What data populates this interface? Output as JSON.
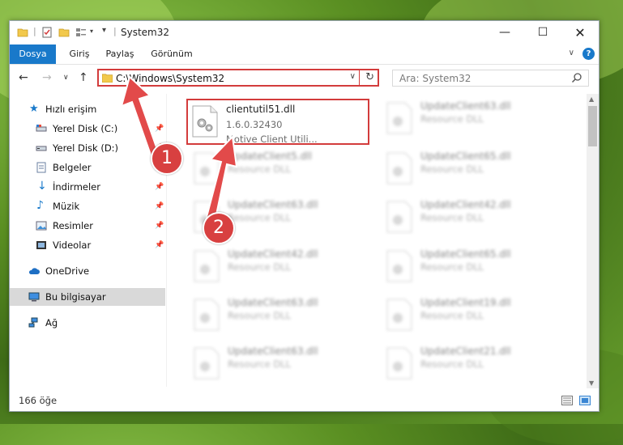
{
  "window": {
    "title": "System32"
  },
  "ribbon": {
    "tabs": [
      "Dosya",
      "Giriş",
      "Paylaş",
      "Görünüm"
    ],
    "help": "?"
  },
  "address": {
    "path": "C:\\Windows\\System32"
  },
  "search": {
    "placeholder": "Ara: System32"
  },
  "sidebar": {
    "items": [
      {
        "label": "Hızlı erişim",
        "icon": "star-icon"
      },
      {
        "label": "Yerel Disk (C:)",
        "icon": "drive-icon"
      },
      {
        "label": "Yerel Disk (D:)",
        "icon": "drive-icon"
      },
      {
        "label": "Belgeler",
        "icon": "documents-icon"
      },
      {
        "label": "İndirmeler",
        "icon": "download-icon"
      },
      {
        "label": "Müzik",
        "icon": "music-icon"
      },
      {
        "label": "Resimler",
        "icon": "pictures-icon"
      },
      {
        "label": "Videolar",
        "icon": "video-icon"
      },
      {
        "label": "OneDrive",
        "icon": "cloud-icon"
      },
      {
        "label": "Bu bilgisayar",
        "icon": "computer-icon"
      },
      {
        "label": "Ağ",
        "icon": "network-icon"
      }
    ]
  },
  "files": [
    {
      "name": "clientutil51.dll",
      "version": "1.6.0.32430",
      "desc": "Motive Client Utili..."
    },
    {
      "name": "UpdateClient63.dll",
      "desc": "Resource DLL"
    },
    {
      "name": "UpdateClient5.dll",
      "desc": "Resource DLL"
    },
    {
      "name": "UpdateClient65.dll",
      "desc": "Resource DLL"
    },
    {
      "name": "UpdateClient63.dll",
      "desc": "Resource DLL"
    },
    {
      "name": "UpdateClient42.dll",
      "desc": "Resource DLL"
    },
    {
      "name": "UpdateClient42.dll",
      "desc": "Resource DLL"
    },
    {
      "name": "UpdateClient65.dll",
      "desc": "Resource DLL"
    },
    {
      "name": "UpdateClient63.dll",
      "desc": "Resource DLL"
    },
    {
      "name": "UpdateClient19.dll",
      "desc": "Resource DLL"
    },
    {
      "name": "UpdateClient63.dll",
      "desc": "Resource DLL"
    },
    {
      "name": "UpdateClient21.dll",
      "desc": "Resource DLL"
    }
  ],
  "status": {
    "count": "166 öğe"
  },
  "annotations": {
    "step1": "1",
    "step2": "2"
  },
  "colors": {
    "accent": "#1979ca",
    "highlight": "#d33c3c"
  }
}
